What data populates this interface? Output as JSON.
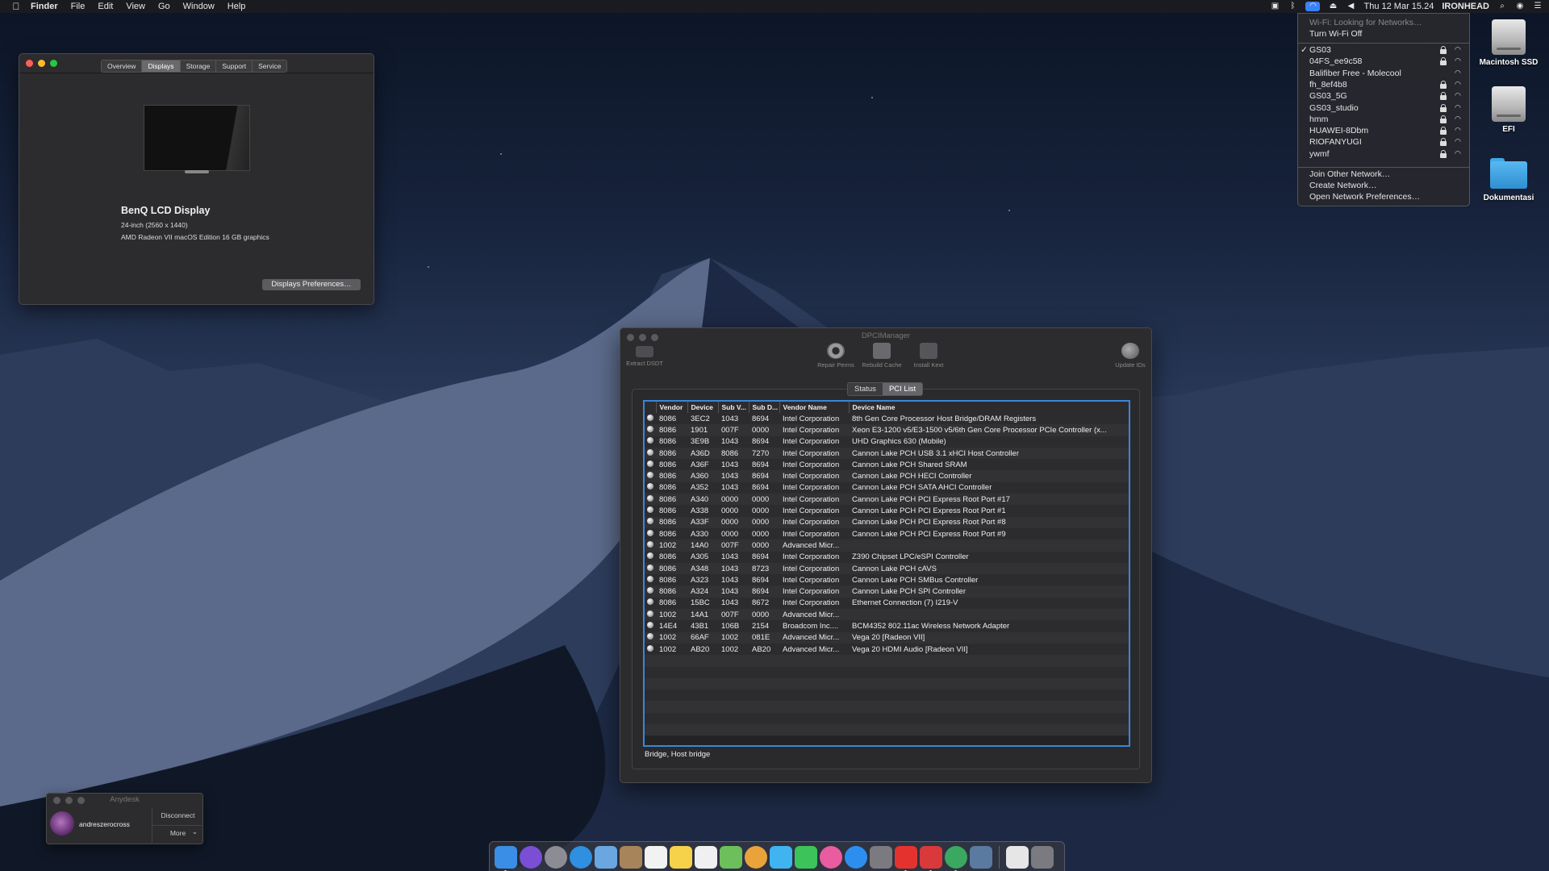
{
  "menubar": {
    "app_name": "Finder",
    "menus": [
      "File",
      "Edit",
      "View",
      "Go",
      "Window",
      "Help"
    ],
    "datetime": "Thu 12 Mar  15.24",
    "user": "IRONHEAD",
    "icons": [
      "apple-icon",
      "screen-icon",
      "bluetooth-icon",
      "wifi-icon",
      "eject-icon",
      "volume-icon",
      "search-icon",
      "siri-icon",
      "list-icon"
    ]
  },
  "wifi_menu": {
    "status": "Wi-Fi: Looking for Networks…",
    "toggle": "Turn Wi-Fi Off",
    "networks": [
      {
        "name": "GS03",
        "checked": true,
        "locked": true
      },
      {
        "name": "04FS_ee9c58",
        "checked": false,
        "locked": true
      },
      {
        "name": "Balifiber Free - Molecool",
        "checked": false,
        "locked": false
      },
      {
        "name": "fh_8ef4b8",
        "checked": false,
        "locked": true
      },
      {
        "name": "GS03_5G",
        "checked": false,
        "locked": true
      },
      {
        "name": "GS03_studio",
        "checked": false,
        "locked": true
      },
      {
        "name": "hmm",
        "checked": false,
        "locked": true
      },
      {
        "name": "HUAWEI-8Dbm",
        "checked": false,
        "locked": true
      },
      {
        "name": "RIOFANYUGI",
        "checked": false,
        "locked": true
      },
      {
        "name": "ywmf",
        "checked": false,
        "locked": true
      }
    ],
    "check_mark": "✓",
    "actions": [
      "Join Other Network…",
      "Create Network…",
      "Open Network Preferences…"
    ]
  },
  "desktop_icons": [
    {
      "label": "Macintosh SSD",
      "kind": "hdd"
    },
    {
      "label": "EFI",
      "kind": "hdd"
    },
    {
      "label": "Dokumentasi",
      "kind": "folder"
    }
  ],
  "about_window": {
    "tabs": [
      "Overview",
      "Displays",
      "Storage",
      "Support",
      "Service"
    ],
    "active_tab": "Displays",
    "display_name": "BenQ LCD Display",
    "display_size": "24-inch (2560 x 1440)",
    "display_gpu": "AMD Radeon VII macOS Edition 16 GB graphics",
    "prefs_button": "Displays Preferences…"
  },
  "dpci": {
    "title": "DPCIManager",
    "toolbar": [
      {
        "label": "Extract DSDT",
        "icon": "tray-icon"
      },
      {
        "label": "Repair Perms",
        "icon": "gear-icon"
      },
      {
        "label": "Rebuild Cache",
        "icon": "camera-icon"
      },
      {
        "label": "Install Kext",
        "icon": "box-icon"
      },
      {
        "label": "Update IDs",
        "icon": "globe-icon"
      }
    ],
    "tabs": [
      "Status",
      "PCI List"
    ],
    "active_tab": "PCI List",
    "columns": [
      "Vendor",
      "Device",
      "Sub V...",
      "Sub D...",
      "Vendor Name",
      "Device Name"
    ],
    "rows": [
      [
        "8086",
        "3EC2",
        "1043",
        "8694",
        "Intel Corporation",
        "8th Gen Core Processor Host Bridge/DRAM Registers"
      ],
      [
        "8086",
        "1901",
        "007F",
        "0000",
        "Intel Corporation",
        "Xeon E3-1200 v5/E3-1500 v5/6th Gen Core Processor PCIe Controller (x..."
      ],
      [
        "8086",
        "3E9B",
        "1043",
        "8694",
        "Intel Corporation",
        "UHD Graphics 630 (Mobile)"
      ],
      [
        "8086",
        "A36D",
        "8086",
        "7270",
        "Intel Corporation",
        "Cannon Lake PCH USB 3.1 xHCI Host Controller"
      ],
      [
        "8086",
        "A36F",
        "1043",
        "8694",
        "Intel Corporation",
        "Cannon Lake PCH Shared SRAM"
      ],
      [
        "8086",
        "A360",
        "1043",
        "8694",
        "Intel Corporation",
        "Cannon Lake PCH HECI Controller"
      ],
      [
        "8086",
        "A352",
        "1043",
        "8694",
        "Intel Corporation",
        "Cannon Lake PCH SATA AHCI Controller"
      ],
      [
        "8086",
        "A340",
        "0000",
        "0000",
        "Intel Corporation",
        "Cannon Lake PCH PCI Express Root Port #17"
      ],
      [
        "8086",
        "A338",
        "0000",
        "0000",
        "Intel Corporation",
        "Cannon Lake PCH PCI Express Root Port #1"
      ],
      [
        "8086",
        "A33F",
        "0000",
        "0000",
        "Intel Corporation",
        "Cannon Lake PCH PCI Express Root Port #8"
      ],
      [
        "8086",
        "A330",
        "0000",
        "0000",
        "Intel Corporation",
        "Cannon Lake PCH PCI Express Root Port #9"
      ],
      [
        "1002",
        "14A0",
        "007F",
        "0000",
        "Advanced Micr...",
        ""
      ],
      [
        "8086",
        "A305",
        "1043",
        "8694",
        "Intel Corporation",
        "Z390 Chipset LPC/eSPI Controller"
      ],
      [
        "8086",
        "A348",
        "1043",
        "8723",
        "Intel Corporation",
        "Cannon Lake PCH cAVS"
      ],
      [
        "8086",
        "A323",
        "1043",
        "8694",
        "Intel Corporation",
        "Cannon Lake PCH SMBus Controller"
      ],
      [
        "8086",
        "A324",
        "1043",
        "8694",
        "Intel Corporation",
        "Cannon Lake PCH SPI Controller"
      ],
      [
        "8086",
        "15BC",
        "1043",
        "8672",
        "Intel Corporation",
        "Ethernet Connection (7) I219-V"
      ],
      [
        "1002",
        "14A1",
        "007F",
        "0000",
        "Advanced Micr...",
        ""
      ],
      [
        "14E4",
        "43B1",
        "106B",
        "2154",
        "Broadcom Inc....",
        "BCM4352 802.11ac Wireless Network Adapter"
      ],
      [
        "1002",
        "66AF",
        "1002",
        "081E",
        "Advanced Micr...",
        "Vega 20 [Radeon VII]"
      ],
      [
        "1002",
        "AB20",
        "1002",
        "AB20",
        "Advanced Micr...",
        "Vega 20 HDMI Audio [Radeon VII]"
      ]
    ],
    "status_line": "Bridge, Host bridge"
  },
  "anydesk": {
    "title": "Anydesk",
    "user": "andreszerocross",
    "disconnect": "Disconnect",
    "more": "More",
    "more_caret": "⌄"
  },
  "dock": {
    "apps": [
      {
        "name": "finder",
        "color": "#3a8ee6",
        "running": true
      },
      {
        "name": "siri",
        "color": "#7a4fd6",
        "running": false
      },
      {
        "name": "launchpad",
        "color": "#8c8c94",
        "running": false
      },
      {
        "name": "safari",
        "color": "#2f8fe0",
        "running": false
      },
      {
        "name": "mail",
        "color": "#6aa7e0",
        "running": false
      },
      {
        "name": "notes-brown",
        "color": "#a8845a",
        "running": false
      },
      {
        "name": "calendar",
        "color": "#f2f2f2",
        "running": false
      },
      {
        "name": "notes",
        "color": "#f5d24a",
        "running": false
      },
      {
        "name": "reminders",
        "color": "#f0f0f0",
        "running": false
      },
      {
        "name": "maps",
        "color": "#6cbf5a",
        "running": false
      },
      {
        "name": "photos",
        "color": "#e9a33a",
        "running": false
      },
      {
        "name": "messages",
        "color": "#3fb4f0",
        "running": false
      },
      {
        "name": "facetime",
        "color": "#3cc35a",
        "running": false
      },
      {
        "name": "itunes",
        "color": "#e95ca0",
        "running": false
      },
      {
        "name": "app-store",
        "color": "#2c8ff0",
        "running": false
      },
      {
        "name": "system-preferences",
        "color": "#7a7a80",
        "running": false
      },
      {
        "name": "anydesk",
        "color": "#e4332e",
        "running": true
      },
      {
        "name": "anydesk-alt",
        "color": "#d9393a",
        "running": true
      },
      {
        "name": "dpcimanager",
        "color": "#3aa860",
        "running": true
      },
      {
        "name": "network-utility",
        "color": "#5a7aa0",
        "running": false
      },
      {
        "name": "document",
        "color": "#e6e6e6",
        "running": false
      },
      {
        "name": "trash",
        "color": "#7a7a80",
        "running": false
      }
    ]
  }
}
